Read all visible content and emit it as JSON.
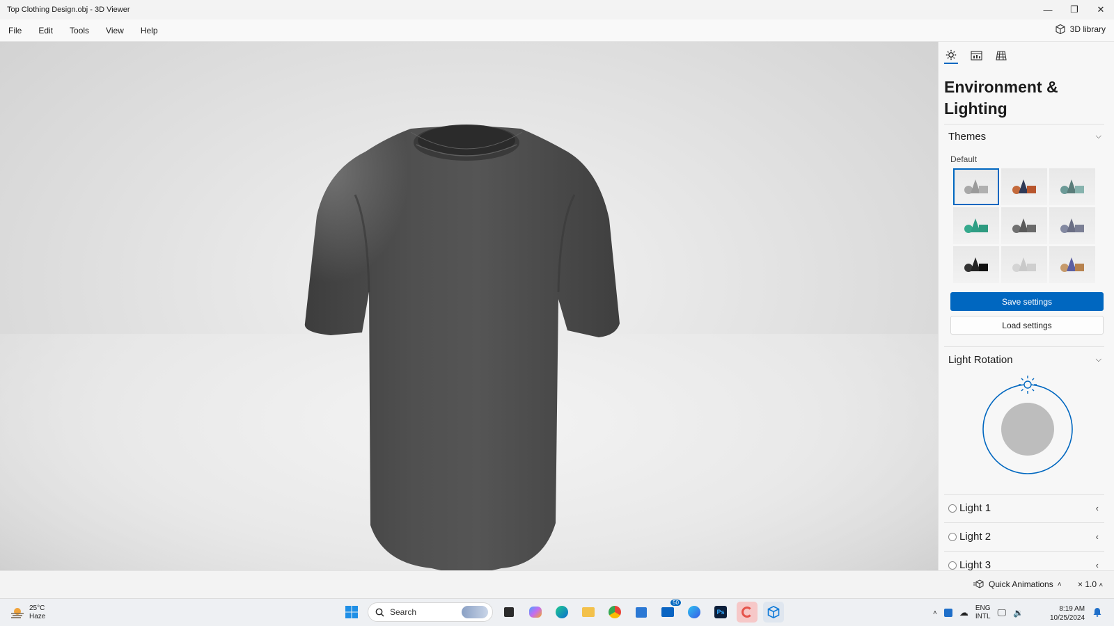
{
  "window": {
    "title": "Top Clothing Design.obj - 3D Viewer",
    "minimize": "—",
    "restore": "❐",
    "close": "✕"
  },
  "menu": {
    "items": [
      "File",
      "Edit",
      "Tools",
      "View",
      "Help"
    ],
    "library_label": "3D library"
  },
  "panel": {
    "tabs": [
      "environment-lighting",
      "stats-shading",
      "grid-views"
    ],
    "title": "Environment & Lighting",
    "themes": {
      "label": "Themes",
      "default_label": "Default",
      "selected_index": 0,
      "swatches": [
        {
          "cone": "#9a9a9a",
          "sphere": "#a8a8a8",
          "box": "#b0b0b0"
        },
        {
          "cone": "#2f3a57",
          "sphere": "#c46a3c",
          "box": "#b8562e"
        },
        {
          "cone": "#5a7d7a",
          "sphere": "#6c9a97",
          "box": "#87b3ae"
        },
        {
          "cone": "#2f9e85",
          "sphere": "#35a98d",
          "box": "#2e9b80"
        },
        {
          "cone": "#5a5a5a",
          "sphere": "#707070",
          "box": "#6a6a6a"
        },
        {
          "cone": "#6b6f85",
          "sphere": "#8389a1",
          "box": "#7b7f95"
        },
        {
          "cone": "#222222",
          "sphere": "#333333",
          "box": "#111111"
        },
        {
          "cone": "#c9c9c9",
          "sphere": "#d4d4d4",
          "box": "#cfcfcf"
        },
        {
          "cone": "#5b5fa3",
          "sphere": "#c69a6b",
          "box": "#b7824e"
        }
      ]
    },
    "save_label": "Save settings",
    "load_label": "Load settings",
    "light_rotation_label": "Light Rotation",
    "lights": [
      "Light 1",
      "Light 2",
      "Light 3"
    ]
  },
  "bottom": {
    "quick_animations": "Quick Animations",
    "speed": "× 1.0"
  },
  "taskbar": {
    "temperature": "25°C",
    "condition": "Haze",
    "search_placeholder": "Search",
    "mail_badge": "50",
    "lang_top": "ENG",
    "lang_bottom": "INTL",
    "time": "8:19 AM",
    "date": "10/25/2024"
  },
  "colors": {
    "accent": "#0067c0",
    "shirt": "#4a4a4a"
  }
}
